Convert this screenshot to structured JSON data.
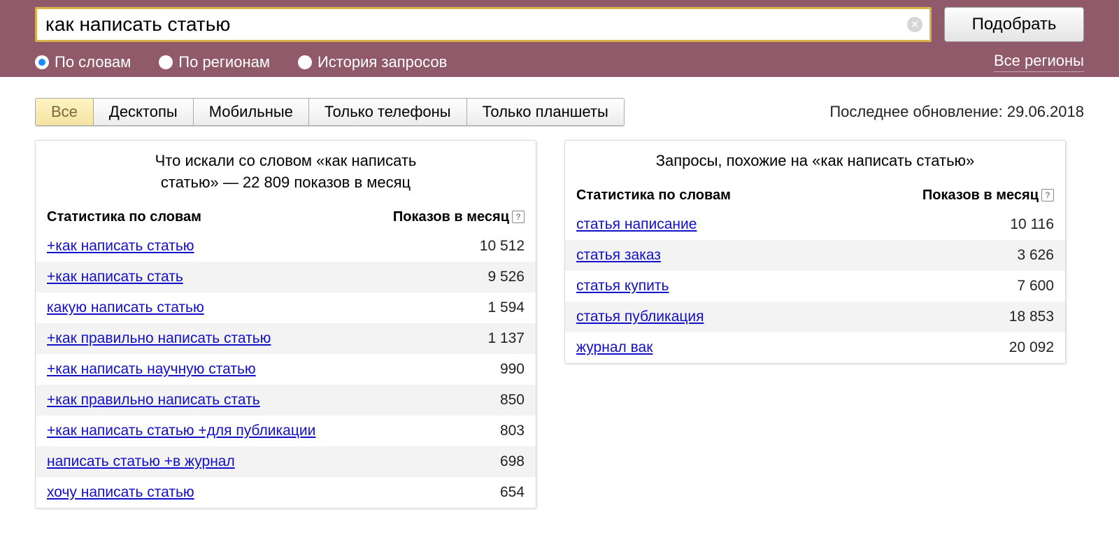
{
  "search": {
    "value": "как написать статью",
    "placeholder": "",
    "submit_label": "Подобрать"
  },
  "filters": {
    "by_words": "По словам",
    "by_regions": "По регионам",
    "history": "История запросов",
    "selected": "by_words",
    "region_link": "Все регионы"
  },
  "tabs": {
    "items": [
      {
        "id": "all",
        "label": "Все"
      },
      {
        "id": "desktops",
        "label": "Десктопы"
      },
      {
        "id": "mobiles",
        "label": "Мобильные"
      },
      {
        "id": "phones",
        "label": "Только телефоны"
      },
      {
        "id": "tablets",
        "label": "Только планшеты"
      }
    ],
    "active": "all"
  },
  "updated_label": "Последнее обновление: 29.06.2018",
  "left_panel": {
    "title_line1": "Что искали со словом «как написать",
    "title_line2": "статью» — 22 809 показов в месяц",
    "col_stat": "Статистика по словам",
    "col_count": "Показов в месяц",
    "rows": [
      {
        "label": "+как написать статью",
        "count": "10 512"
      },
      {
        "label": "+как написать стать",
        "count": "9 526"
      },
      {
        "label": "какую написать статью",
        "count": "1 594"
      },
      {
        "label": "+как правильно написать статью",
        "count": "1 137"
      },
      {
        "label": "+как написать научную статью",
        "count": "990"
      },
      {
        "label": "+как правильно написать стать",
        "count": "850"
      },
      {
        "label": "+как написать статью +для публикации",
        "count": "803"
      },
      {
        "label": "написать статью +в журнал",
        "count": "698"
      },
      {
        "label": "хочу написать статью",
        "count": "654"
      }
    ]
  },
  "right_panel": {
    "title": "Запросы, похожие на «как написать статью»",
    "col_stat": "Статистика по словам",
    "col_count": "Показов в месяц",
    "rows": [
      {
        "label": "статья написание",
        "count": "10 116"
      },
      {
        "label": "статья заказ",
        "count": "3 626"
      },
      {
        "label": "статья купить",
        "count": "7 600"
      },
      {
        "label": "статья публикация",
        "count": "18 853"
      },
      {
        "label": "журнал вак",
        "count": "20 092"
      }
    ]
  }
}
